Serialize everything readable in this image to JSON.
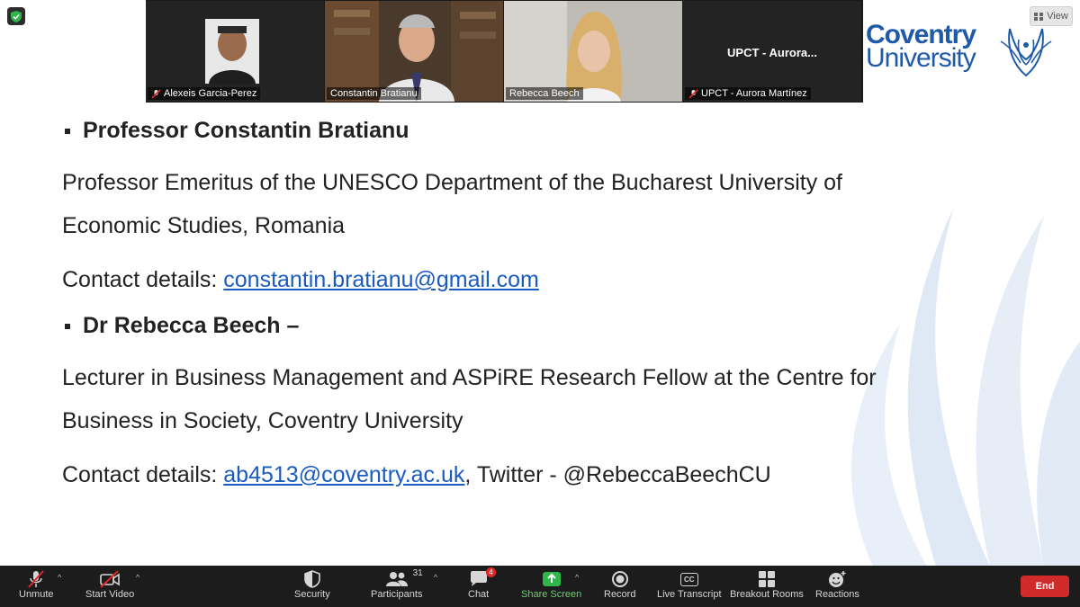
{
  "view_button": {
    "label": "View"
  },
  "participants_strip": [
    {
      "name": "Alexeis Garcia-Perez",
      "muted": true
    },
    {
      "name": "Constantin Bratianu",
      "muted": false
    },
    {
      "name": "Rebecca Beech",
      "muted": false
    },
    {
      "name": "UPCT - Aurora Martínez",
      "center_label": "UPCT  - Aurora...",
      "muted": true
    }
  ],
  "logo": {
    "line1": "Coventry",
    "line2": "University"
  },
  "slide": {
    "person1": {
      "heading": "Professor Constantin Bratianu",
      "description": "Professor Emeritus of the UNESCO Department of the Bucharest University of Economic Studies, Romania",
      "contact_prefix": "Contact details: ",
      "email": "constantin.bratianu@gmail.com"
    },
    "person2": {
      "heading": "Dr Rebecca Beech –",
      "description": "Lecturer in Business Management and ASPiRE Research Fellow at the Centre for Business in Society, Coventry University",
      "contact_prefix": "Contact details: ",
      "email": "ab4513@coventry.ac.uk",
      "contact_suffix": ", Twitter - @RebeccaBeechCU"
    }
  },
  "toolbar": {
    "unmute": "Unmute",
    "start_video": "Start Video",
    "security": "Security",
    "participants": "Participants",
    "participants_count": "31",
    "chat": "Chat",
    "chat_badge": "4",
    "share_screen": "Share Screen",
    "record": "Record",
    "live_transcript": "Live Transcript",
    "cc_text": "CC",
    "breakout_rooms": "Breakout Rooms",
    "reactions": "Reactions",
    "end": "End"
  },
  "colors": {
    "accent_green": "#6cd26c",
    "end_red": "#d02a2a",
    "link_blue": "#1a5bbf",
    "brand_blue": "#1f5aa8"
  }
}
